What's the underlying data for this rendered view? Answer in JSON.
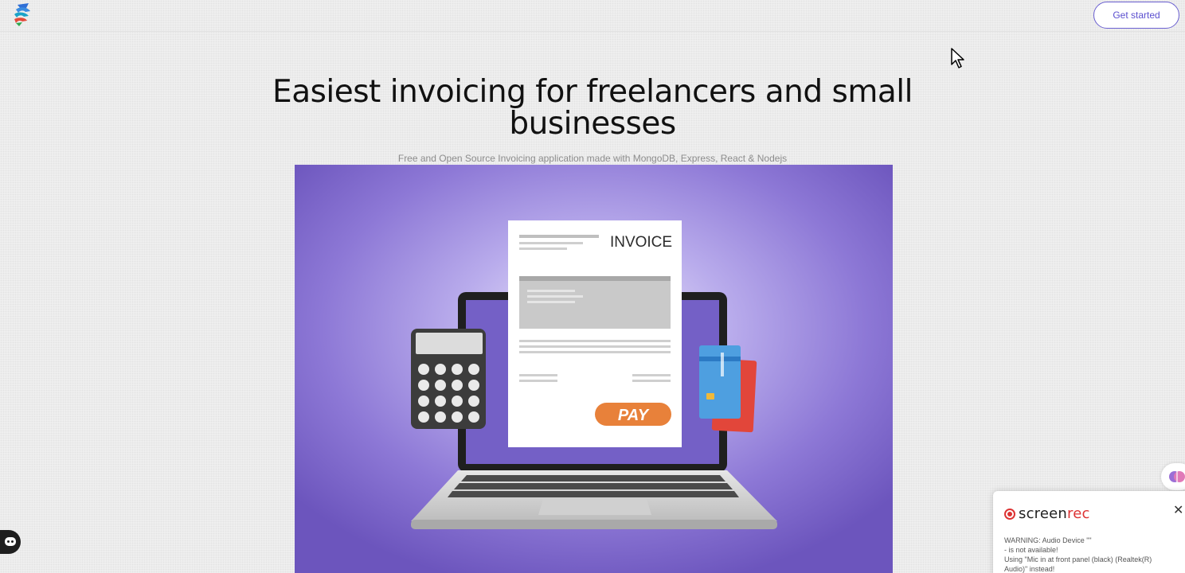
{
  "header": {
    "logo_icon": "app-logo-icon",
    "cta_label": "Get started"
  },
  "hero": {
    "title": "Easiest invoicing for freelancers and small businesses",
    "subtitle": "Free and Open Source Invoicing application made with MongoDB, Express, React & Nodejs",
    "illustration": {
      "invoice_heading": "INVOICE",
      "pay_label": "PAY"
    }
  },
  "colors": {
    "accent": "#5b4fcf",
    "illustration_bg": "#7a66c8",
    "pay_button": "#e8813a",
    "recording_red": "#d33333"
  },
  "screenrec": {
    "brand_screen": "screen",
    "brand_rec": "rec",
    "close_label": "✕",
    "warning_lines": [
      "WARNING: Audio Device \"\"",
      "- is not available!",
      "Using \"Mic in at front panel (black) (Realtek(R)",
      "Audio)\" instead!"
    ]
  }
}
